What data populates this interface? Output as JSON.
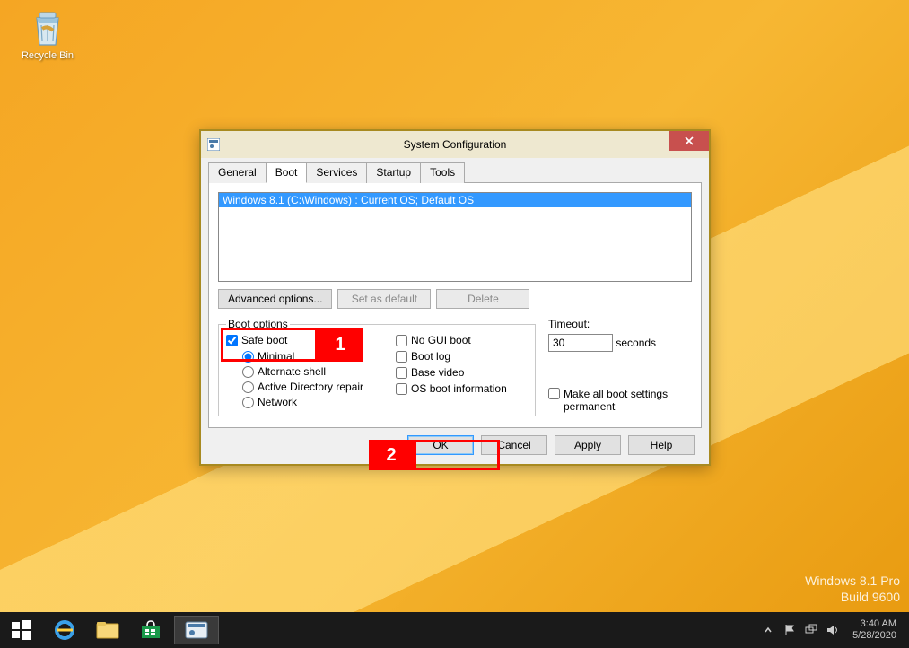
{
  "desktop": {
    "recycle_bin_label": "Recycle Bin"
  },
  "window": {
    "title": "System Configuration",
    "tabs": [
      "General",
      "Boot",
      "Services",
      "Startup",
      "Tools"
    ],
    "active_tab": "Boot",
    "os_list": [
      "Windows 8.1 (C:\\Windows) : Current OS; Default OS"
    ],
    "buttons": {
      "advanced": "Advanced options...",
      "set_default": "Set as default",
      "delete": "Delete"
    },
    "boot_options_legend": "Boot options",
    "safe_boot": {
      "label": "Safe boot",
      "checked": true
    },
    "radios": {
      "minimal": "Minimal",
      "alternate_shell": "Alternate shell",
      "ad_repair": "Active Directory repair",
      "network": "Network",
      "selected": "minimal"
    },
    "right_checks": {
      "no_gui": "No GUI boot",
      "boot_log": "Boot log",
      "base_video": "Base video",
      "os_boot_info": "OS boot information"
    },
    "timeout": {
      "label": "Timeout:",
      "value": "30",
      "suffix": "seconds"
    },
    "permanent": "Make all boot settings permanent",
    "bottom": {
      "ok": "OK",
      "cancel": "Cancel",
      "apply": "Apply",
      "help": "Help"
    }
  },
  "callouts": {
    "one": "1",
    "two": "2"
  },
  "watermark": {
    "line1": "Windows 8.1 Pro",
    "line2": "Build 9600"
  },
  "taskbar": {
    "time": "3:40 AM",
    "date": "5/28/2020"
  }
}
